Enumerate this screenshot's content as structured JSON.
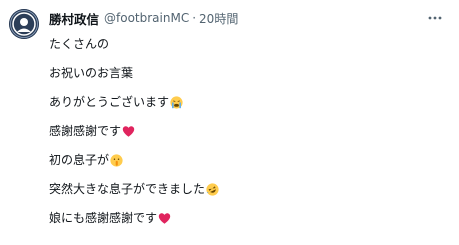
{
  "tweet": {
    "author": {
      "display_name": "勝村政信",
      "handle": "@footbrainMC",
      "separator": "·",
      "time": "20時間"
    },
    "more_icon": "ellipsis-icon",
    "lines": [
      {
        "text": "たくさんの",
        "emoji": ""
      },
      {
        "text": "お祝いのお言葉",
        "emoji": ""
      },
      {
        "text": "ありがとうございます",
        "emoji": "crying-face-icon"
      },
      {
        "text": "感謝感謝です",
        "emoji": "red-heart-icon"
      },
      {
        "text": "初の息子が",
        "emoji": "shushing-face-icon"
      },
      {
        "text": "突然大きな息子ができました",
        "emoji": "rofl-face-icon"
      },
      {
        "text": "娘にも感謝感謝です",
        "emoji": "red-heart-icon"
      }
    ],
    "colors": {
      "text": "#0f1419",
      "secondary": "#536471",
      "heart": "#e0245e",
      "emoji_yellow": "#ffcc4d"
    }
  }
}
